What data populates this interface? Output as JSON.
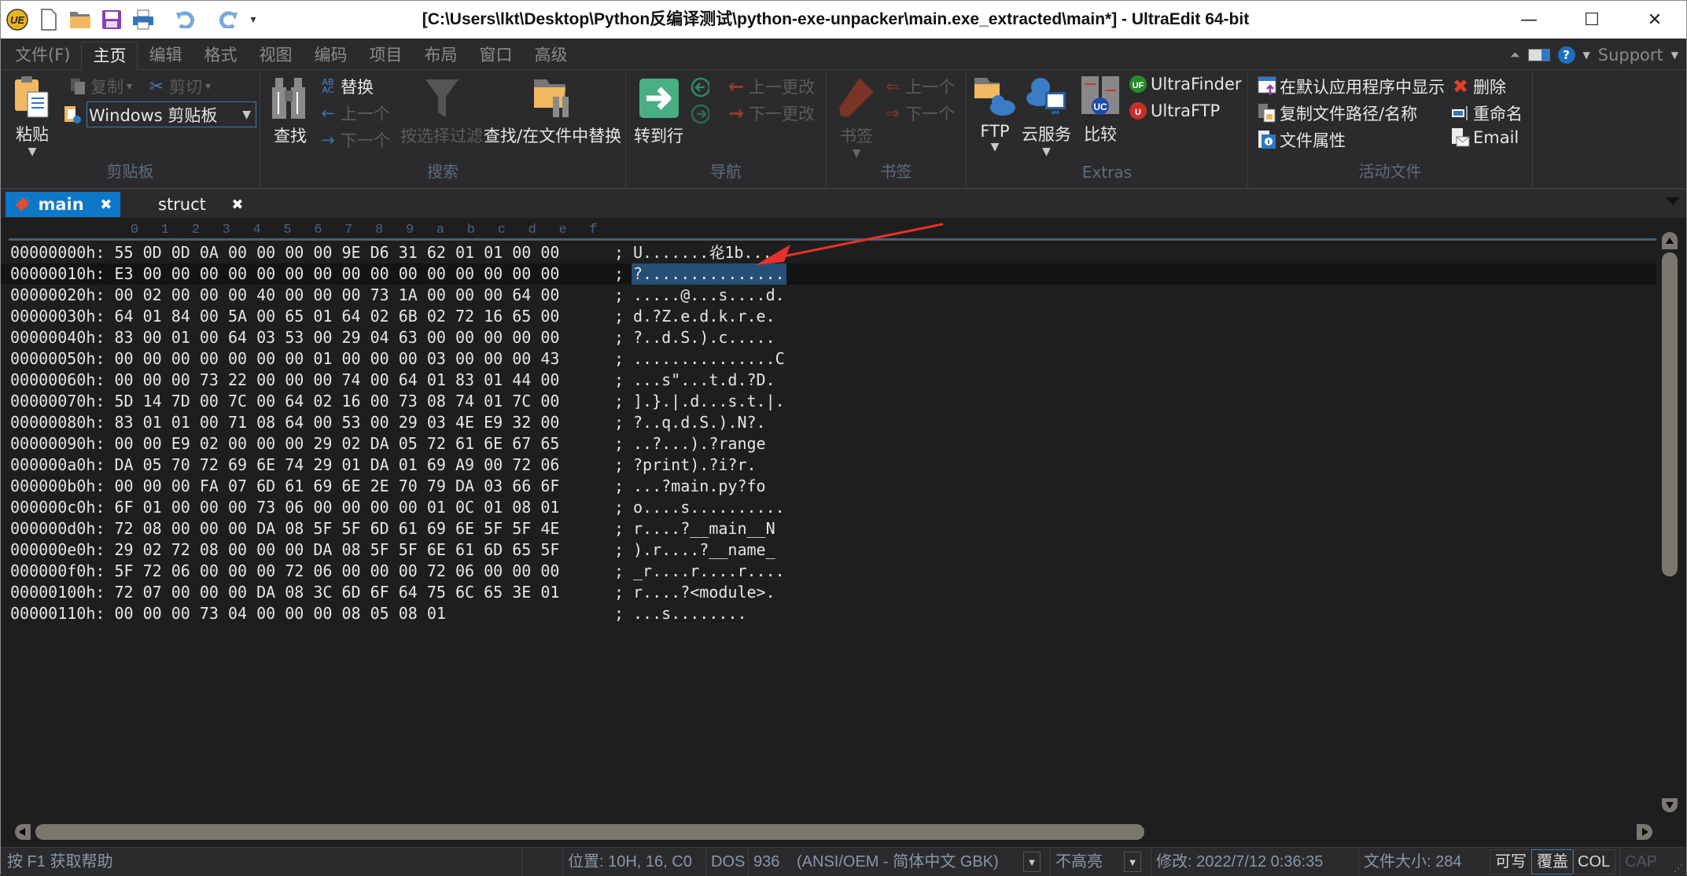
{
  "titlebar": {
    "title": "[C:\\Users\\lkt\\Desktop\\Python反编译测试\\python-exe-unpacker\\main.exe_extracted\\main*] - UltraEdit 64-bit",
    "quick_access": [
      "app-logo",
      "new-file",
      "open-folder",
      "save",
      "print",
      "undo",
      "redo",
      "customize"
    ],
    "controls": {
      "minimize": "—",
      "maximize": "☐",
      "close": "✕"
    }
  },
  "menubar": {
    "tabs": [
      "文件(F)",
      "主页",
      "编辑",
      "格式",
      "视图",
      "编码",
      "项目",
      "布局",
      "窗口",
      "高级"
    ],
    "active_tab": "主页",
    "support_label": "Support"
  },
  "ribbon": {
    "clipboard": {
      "label": "剪贴板",
      "paste": "粘贴",
      "copy": "复制",
      "cut": "剪切",
      "clipboard_select": "Windows 剪贴板"
    },
    "search": {
      "label": "搜索",
      "find": "查找",
      "replace": "替换",
      "prev": "上一个",
      "next": "下一个",
      "filter": "按选择过滤",
      "find_in_files": "查找/在文件中替换"
    },
    "navigation": {
      "label": "导航",
      "goto": "转到行",
      "prev_change": "上一更改",
      "next_change": "下一更改"
    },
    "bookmarks": {
      "label": "书签",
      "bookmark": "书签",
      "prev": "上一个",
      "next": "下一个"
    },
    "extras": {
      "label": "Extras",
      "ftp": "FTP",
      "cloud": "云服务",
      "compare": "比较",
      "ultrafinder": "UltraFinder",
      "ultraftp": "UltraFTP"
    },
    "active_file": {
      "label": "活动文件",
      "show_default": "在默认应用程序中显示",
      "copy_path": "复制文件路径/名称",
      "properties": "文件属性",
      "delete": "删除",
      "rename": "重命名",
      "email": "Email"
    }
  },
  "tabs": [
    {
      "label": "main",
      "active": true
    },
    {
      "label": "struct",
      "active": false
    }
  ],
  "editor": {
    "column_header": [
      "0",
      "1",
      "2",
      "3",
      "4",
      "5",
      "6",
      "7",
      "8",
      "9",
      "a",
      "b",
      "c",
      "d",
      "e",
      "f"
    ],
    "current_row": 1,
    "rows": [
      {
        "offset": "00000000h:",
        "hex": "55 0D 0D 0A 00 00 00 00 9E D6 31 62 01 01 00 00",
        "ascii": "U.......炛1b...."
      },
      {
        "offset": "00000010h:",
        "hex": "E3 00 00 00 00 00 00 00 00 00 00 00 00 00 00 00",
        "ascii": "?..............."
      },
      {
        "offset": "00000020h:",
        "hex": "00 02 00 00 00 40 00 00 00 73 1A 00 00 00 64 00",
        "ascii": ".....@...s....d."
      },
      {
        "offset": "00000030h:",
        "hex": "64 01 84 00 5A 00 65 01 64 02 6B 02 72 16 65 00",
        "ascii": "d.?Z.e.d.k.r.e."
      },
      {
        "offset": "00000040h:",
        "hex": "83 00 01 00 64 03 53 00 29 04 63 00 00 00 00 00",
        "ascii": "?..d.S.).c....."
      },
      {
        "offset": "00000050h:",
        "hex": "00 00 00 00 00 00 00 01 00 00 00 03 00 00 00 43",
        "ascii": "...............C"
      },
      {
        "offset": "00000060h:",
        "hex": "00 00 00 73 22 00 00 00 74 00 64 01 83 01 44 00",
        "ascii": "...s\"...t.d.?D."
      },
      {
        "offset": "00000070h:",
        "hex": "5D 14 7D 00 7C 00 64 02 16 00 73 08 74 01 7C 00",
        "ascii": "].}.|.d...s.t.|."
      },
      {
        "offset": "00000080h:",
        "hex": "83 01 01 00 71 08 64 00 53 00 29 03 4E E9 32 00",
        "ascii": "?..q.d.S.).N?."
      },
      {
        "offset": "00000090h:",
        "hex": "00 00 E9 02 00 00 00 29 02 DA 05 72 61 6E 67 65",
        "ascii": "..?...).?range"
      },
      {
        "offset": "000000a0h:",
        "hex": "DA 05 70 72 69 6E 74 29 01 DA 01 69 A9 00 72 06",
        "ascii": "?print).?i?r."
      },
      {
        "offset": "000000b0h:",
        "hex": "00 00 00 FA 07 6D 61 69 6E 2E 70 79 DA 03 66 6F",
        "ascii": "...?main.py?fo"
      },
      {
        "offset": "000000c0h:",
        "hex": "6F 01 00 00 00 73 06 00 00 00 00 01 0C 01 08 01",
        "ascii": "o....s.........."
      },
      {
        "offset": "000000d0h:",
        "hex": "72 08 00 00 00 DA 08 5F 5F 6D 61 69 6E 5F 5F 4E",
        "ascii": "r....?__main__N"
      },
      {
        "offset": "000000e0h:",
        "hex": "29 02 72 08 00 00 00 DA 08 5F 5F 6E 61 6D 65 5F",
        "ascii": ").r....?__name_"
      },
      {
        "offset": "000000f0h:",
        "hex": "5F 72 06 00 00 00 72 06 00 00 00 72 06 00 00 00",
        "ascii": "_r....r....r...."
      },
      {
        "offset": "00000100h:",
        "hex": "72 07 00 00 00 DA 08 3C 6D 6F 64 75 6C 65 3E 01",
        "ascii": "r....?<module>."
      },
      {
        "offset": "00000110h:",
        "hex": "00 00 00 73 04 00 00 00 08 05 08 01            ",
        "ascii": "...s........"
      }
    ]
  },
  "statusbar": {
    "help": "按 F1 获取帮助",
    "position": "位置: 10H, 16, C0",
    "line_ending": "DOS",
    "codepage": "936",
    "encoding": "(ANSI/OEM - 简体中文 GBK)",
    "highlight": "不高亮",
    "modified": "修改:   2022/7/12 0:36:35",
    "filesize": "文件大小:   284",
    "writable": "可写",
    "overwrite": "覆盖",
    "col": "COL",
    "cap": "CAP"
  },
  "colors": {
    "accent_tab": "#0e78c8",
    "selection": "#264f78",
    "annotation_arrow": "#e8312a"
  }
}
